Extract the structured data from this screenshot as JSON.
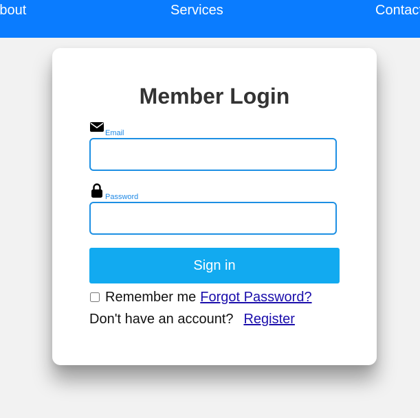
{
  "nav": {
    "about_label": "About",
    "services_label": "Services",
    "contact_label": "Contact"
  },
  "login": {
    "title": "Member Login",
    "email_label": "Email",
    "email_value": "",
    "email_icon": "envelope-icon",
    "password_label": "Password",
    "password_value": "",
    "password_icon": "lock-icon",
    "signin_label": "Sign in",
    "remember_label": "Remember me",
    "remember_checked": false,
    "forgot_label": "Forgot Password?",
    "no_account_text": "Don't have an account?",
    "register_label": "Register"
  },
  "colors": {
    "nav_bg": "#0a7cff",
    "button_bg": "#12aaf0",
    "input_border": "#1c8fe3",
    "link": "#1a0dab"
  }
}
